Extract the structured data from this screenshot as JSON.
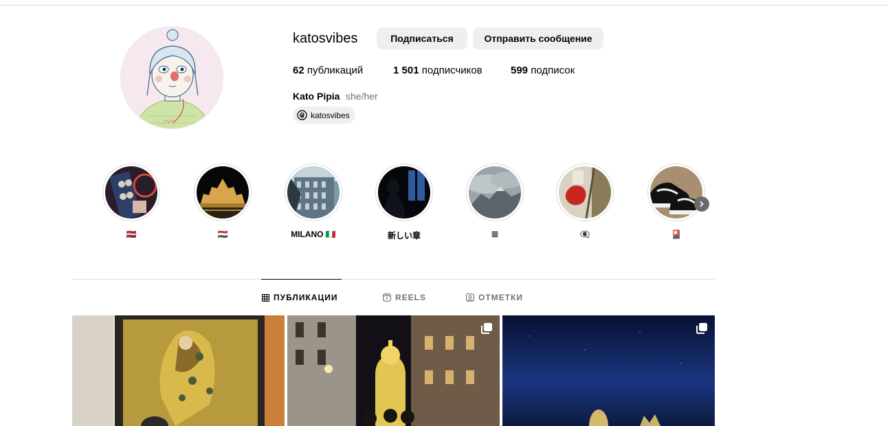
{
  "profile": {
    "username": "katosvibes",
    "follow_label": "Подписаться",
    "message_label": "Отправить сообщение",
    "stats": {
      "posts_count": "62",
      "posts_label": "публикаций",
      "followers_count": "1 501",
      "followers_label": "подписчиков",
      "following_count": "599",
      "following_label": "подписок"
    },
    "full_name": "Kato Pipia",
    "pronouns": "she/her",
    "threads_handle": "katosvibes"
  },
  "highlights": [
    {
      "label": "🇱🇻",
      "icon": "photo-booth-strip"
    },
    {
      "label": "🇭🇺",
      "icon": "parliament-night"
    },
    {
      "label": "MILANO 🇮🇹",
      "icon": "milan-building"
    },
    {
      "label": "新しい章",
      "icon": "silhouette-window"
    },
    {
      "label": "𝌆",
      "icon": "mountain-clouds"
    },
    {
      "label": "👁‍🗨",
      "icon": "red-object"
    },
    {
      "label": "🎴",
      "icon": "sneakers"
    }
  ],
  "tabs": [
    {
      "label": "ПУБЛИКАЦИИ",
      "icon": "grid-icon",
      "active": true
    },
    {
      "label": "REELS",
      "icon": "reels-icon",
      "active": false
    },
    {
      "label": "ОТМЕТКИ",
      "icon": "tagged-icon",
      "active": false
    }
  ],
  "colors": {
    "button_bg": "#efefef",
    "muted_text": "#737373",
    "divider": "#dbdbdb"
  }
}
